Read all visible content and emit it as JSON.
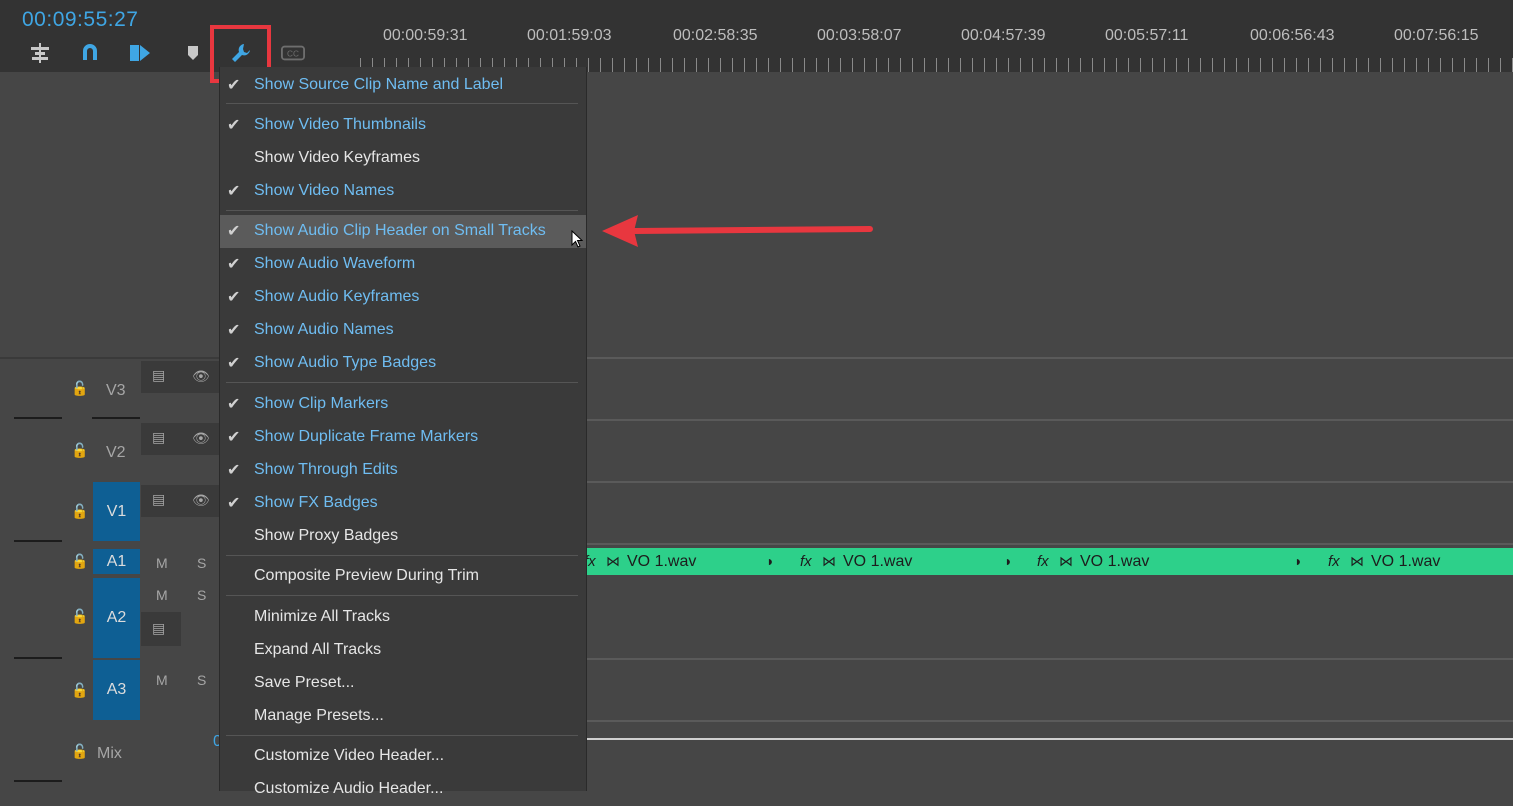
{
  "timecode": "00:09:55:27",
  "ruler": {
    "labels": [
      "00:00:59:31",
      "00:01:59:03",
      "00:02:58:35",
      "00:03:58:07",
      "00:04:57:39",
      "00:05:57:11",
      "00:06:56:43",
      "00:07:56:15"
    ]
  },
  "tracks": {
    "v3": "V3",
    "v2": "V2",
    "v1": "V1",
    "a1": "A1",
    "a2": "A2",
    "a3": "A3",
    "mix": "Mix",
    "mute": "M",
    "solo": "S",
    "mix_value_fragment": "0"
  },
  "clips": [
    "VO 1.wav",
    "VO 1.wav",
    "VO 1.wav",
    "VO 1.wav"
  ],
  "fx_label": "fx",
  "menu": {
    "items": [
      {
        "label": "Show Source Clip Name and Label",
        "checked": true
      },
      {
        "label": "Show Video Thumbnails",
        "checked": true
      },
      {
        "label": "Show Video Keyframes",
        "checked": false
      },
      {
        "label": "Show Video Names",
        "checked": true
      },
      {
        "label": "Show Audio Clip Header on Small Tracks",
        "checked": true
      },
      {
        "label": "Show Audio Waveform",
        "checked": true
      },
      {
        "label": "Show Audio Keyframes",
        "checked": true
      },
      {
        "label": "Show Audio Names",
        "checked": true
      },
      {
        "label": "Show Audio Type Badges",
        "checked": true
      },
      {
        "label": "Show Clip Markers",
        "checked": true
      },
      {
        "label": "Show Duplicate Frame Markers",
        "checked": true
      },
      {
        "label": "Show Through Edits",
        "checked": true
      },
      {
        "label": "Show FX Badges",
        "checked": true
      },
      {
        "label": "Show Proxy Badges",
        "checked": false
      },
      {
        "label": "Composite Preview During Trim",
        "checked": false
      },
      {
        "label": "Minimize All Tracks",
        "checked": false
      },
      {
        "label": "Expand All Tracks",
        "checked": false
      },
      {
        "label": "Save Preset...",
        "checked": false
      },
      {
        "label": "Manage Presets...",
        "checked": false
      },
      {
        "label": "Customize Video Header...",
        "checked": false
      },
      {
        "label": "Customize Audio Header...",
        "checked": false
      }
    ]
  },
  "colors": {
    "accent": "#3fa6e4",
    "highlight_box": "#e8373f",
    "clip": "#2dd08a",
    "track_selected": "#0e5f94"
  }
}
